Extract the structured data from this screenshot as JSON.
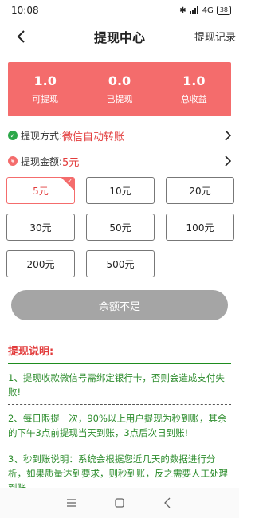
{
  "status_bar": {
    "time": "10:08",
    "network": "4G",
    "battery": "38"
  },
  "nav": {
    "title": "提现中心",
    "right_link": "提现记录"
  },
  "summary": {
    "items": [
      {
        "value": "1.0",
        "label": "可提现"
      },
      {
        "value": "0.0",
        "label": "已提现"
      },
      {
        "value": "1.0",
        "label": "总收益"
      }
    ]
  },
  "method_row": {
    "label": "提现方式:",
    "value": "微信自动转账"
  },
  "amount_row": {
    "label": "提现金额:",
    "value": "5元"
  },
  "amounts": [
    "5元",
    "10元",
    "20元",
    "30元",
    "50元",
    "100元",
    "200元",
    "500元"
  ],
  "selected_amount": "5元",
  "submit": {
    "label": "余额不足"
  },
  "instructions": {
    "title": "提现说明:",
    "items": [
      "1、提现收款微信号需绑定银行卡，否则会造成支付失败!",
      "2、每日限提一次，90%以上用户提现为秒到账，其余的下午3点前提现当天到账，3点后次日到账!",
      "3、秒到账说明：系统会根据您近几天的数据进行分析，如果质量达到要求，则秒到账，反之需要人工处理到账，"
    ]
  },
  "colors": {
    "accent": "#f46c6c",
    "red_text": "#e23b3b",
    "green_text": "#2c8c2c",
    "disabled": "#a5a5a5"
  },
  "icons": {
    "back": "chevron-left-icon",
    "method": "check-circle-icon",
    "amount": "yen-circle-icon",
    "arrow": "chevron-right-icon"
  }
}
